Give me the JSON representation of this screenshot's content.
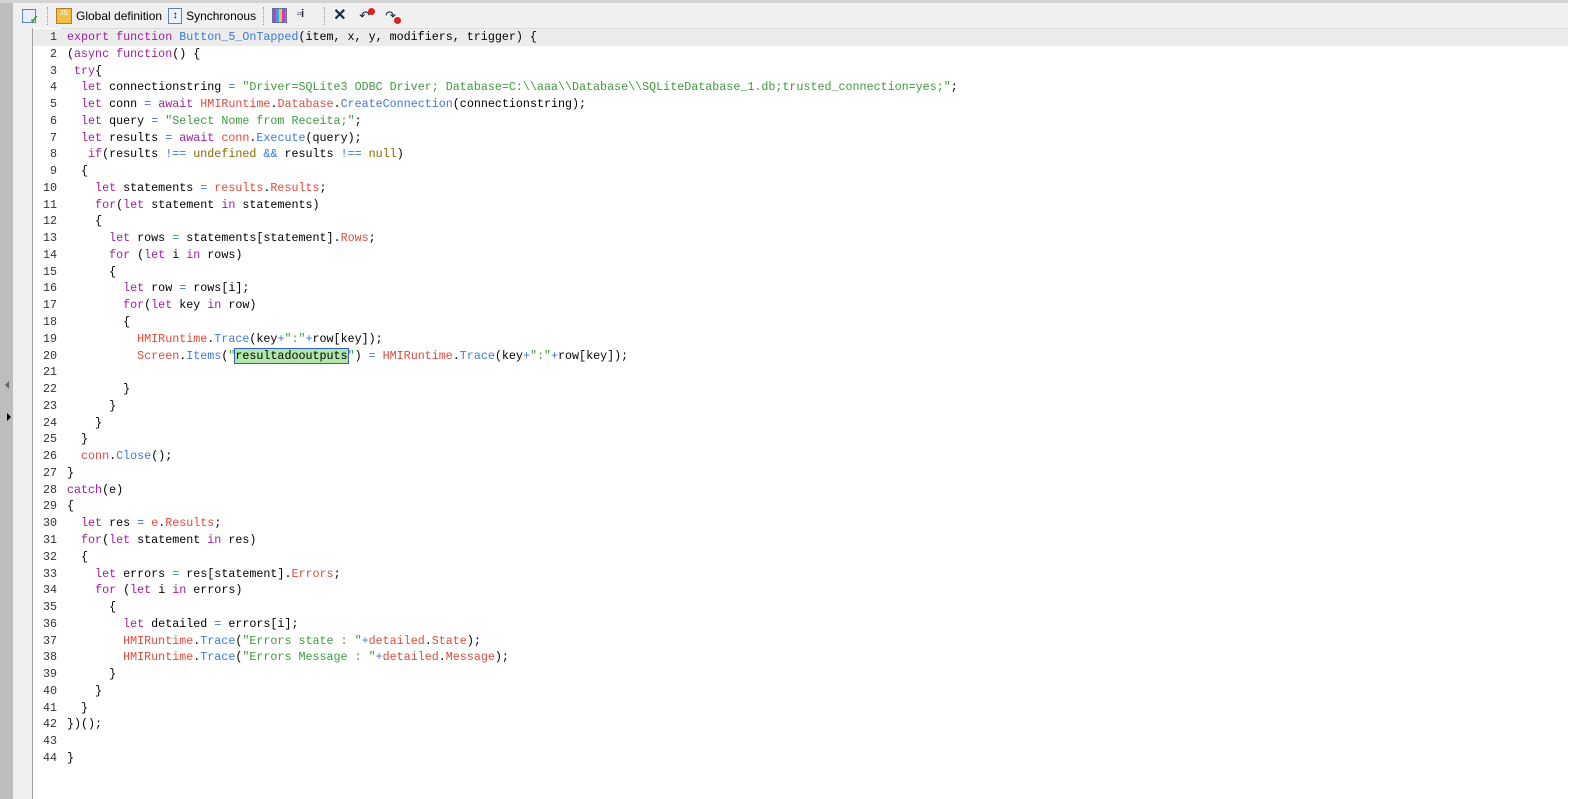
{
  "toolbar": {
    "items": [
      {
        "icon": "check-syntax-icon",
        "label": ""
      },
      {
        "icon": "js-global-definition-icon",
        "label": "Global definition"
      },
      {
        "icon": "synchronous-icon",
        "label": "Synchronous"
      },
      {
        "icon": "snippets-icon",
        "label": ""
      },
      {
        "icon": "info-icon",
        "label": ""
      },
      {
        "icon": "delete-icon",
        "label": ""
      },
      {
        "icon": "remove-breakpoint-icon",
        "label": ""
      },
      {
        "icon": "remove-all-breakpoints-icon",
        "label": ""
      }
    ]
  },
  "colors": {
    "keyword": "#a020a0",
    "function": "#3c78d8",
    "object": "#e04a3c",
    "string": "#3e9a3e",
    "constant": "#8b6a00"
  },
  "code": {
    "current_line": 1,
    "highlight_word": "resultadooutputs",
    "lines": [
      [
        [
          "k",
          "export function "
        ],
        [
          "f",
          "Button_5_OnTapped"
        ],
        [
          "p",
          "(item, x, y, modifiers, trigger) {"
        ]
      ],
      [
        [
          "p",
          "("
        ],
        [
          "k",
          "async function"
        ],
        [
          "p",
          "() {"
        ]
      ],
      [
        [
          "k",
          " try"
        ],
        [
          "p",
          "{"
        ]
      ],
      [
        [
          "k",
          "  let "
        ],
        [
          "p",
          "connectionstring "
        ],
        [
          "f",
          "= "
        ],
        [
          "s",
          "\"Driver=SQLite3 ODBC Driver; Database=C:\\\\aaa\\\\Database\\\\SQLiteDatabase_1.db;trusted_connection=yes;\""
        ],
        [
          "p",
          ";"
        ]
      ],
      [
        [
          "k",
          "  let "
        ],
        [
          "p",
          "conn "
        ],
        [
          "f",
          "= "
        ],
        [
          "k",
          "await "
        ],
        [
          "o",
          "HMIRuntime"
        ],
        [
          "p",
          "."
        ],
        [
          "o",
          "Database"
        ],
        [
          "p",
          "."
        ],
        [
          "f",
          "CreateConnection"
        ],
        [
          "p",
          "(connectionstring);"
        ]
      ],
      [
        [
          "k",
          "  let "
        ],
        [
          "p",
          "query "
        ],
        [
          "f",
          "= "
        ],
        [
          "s",
          "\"Select Nome from Receita;\""
        ],
        [
          "p",
          ";"
        ]
      ],
      [
        [
          "k",
          "  let "
        ],
        [
          "p",
          "results "
        ],
        [
          "f",
          "= "
        ],
        [
          "k",
          "await "
        ],
        [
          "o",
          "conn"
        ],
        [
          "p",
          "."
        ],
        [
          "f",
          "Execute"
        ],
        [
          "p",
          "(query);"
        ]
      ],
      [
        [
          "k",
          "   if"
        ],
        [
          "p",
          "(results "
        ],
        [
          "f",
          "!== "
        ],
        [
          "c",
          "undefined "
        ],
        [
          "f",
          "&& "
        ],
        [
          "p",
          "results "
        ],
        [
          "f",
          "!== "
        ],
        [
          "c",
          "null"
        ],
        [
          "p",
          ")"
        ]
      ],
      [
        [
          "p",
          "  {"
        ]
      ],
      [
        [
          "k",
          "    let "
        ],
        [
          "p",
          "statements "
        ],
        [
          "f",
          "= "
        ],
        [
          "o",
          "results"
        ],
        [
          "p",
          "."
        ],
        [
          "o",
          "Results"
        ],
        [
          "p",
          ";"
        ]
      ],
      [
        [
          "k",
          "    for"
        ],
        [
          "p",
          "("
        ],
        [
          "k",
          "let "
        ],
        [
          "p",
          "statement "
        ],
        [
          "k",
          "in "
        ],
        [
          "p",
          "statements)"
        ]
      ],
      [
        [
          "p",
          "    {"
        ]
      ],
      [
        [
          "k",
          "      let "
        ],
        [
          "p",
          "rows "
        ],
        [
          "f",
          "= "
        ],
        [
          "p",
          "statements[statement]."
        ],
        [
          "o",
          "Rows"
        ],
        [
          "p",
          ";"
        ]
      ],
      [
        [
          "k",
          "      for "
        ],
        [
          "p",
          "("
        ],
        [
          "k",
          "let "
        ],
        [
          "p",
          "i "
        ],
        [
          "k",
          "in "
        ],
        [
          "p",
          "rows)"
        ]
      ],
      [
        [
          "p",
          "      {"
        ]
      ],
      [
        [
          "k",
          "        let "
        ],
        [
          "p",
          "row "
        ],
        [
          "f",
          "= "
        ],
        [
          "p",
          "rows[i];"
        ]
      ],
      [
        [
          "k",
          "        for"
        ],
        [
          "p",
          "("
        ],
        [
          "k",
          "let "
        ],
        [
          "p",
          "key "
        ],
        [
          "k",
          "in "
        ],
        [
          "p",
          "row)"
        ]
      ],
      [
        [
          "p",
          "        {"
        ]
      ],
      [
        [
          "o",
          "          HMIRuntime"
        ],
        [
          "p",
          "."
        ],
        [
          "f",
          "Trace"
        ],
        [
          "p",
          "(key"
        ],
        [
          "f",
          "+"
        ],
        [
          "s",
          "\":\""
        ],
        [
          "f",
          "+"
        ],
        [
          "p",
          "row[key]);"
        ]
      ],
      [
        [
          "o",
          "          Screen"
        ],
        [
          "p",
          "."
        ],
        [
          "f",
          "Items"
        ],
        [
          "p",
          "("
        ],
        [
          "s",
          "\""
        ],
        [
          "hl",
          "resultadooutputs"
        ],
        [
          "s",
          "\""
        ],
        [
          "p",
          ") "
        ],
        [
          "f",
          "= "
        ],
        [
          "o",
          "HMIRuntime"
        ],
        [
          "p",
          "."
        ],
        [
          "f",
          "Trace"
        ],
        [
          "p",
          "(key"
        ],
        [
          "f",
          "+"
        ],
        [
          "s",
          "\":\""
        ],
        [
          "f",
          "+"
        ],
        [
          "p",
          "row[key]);"
        ]
      ],
      [
        [
          "p",
          ""
        ]
      ],
      [
        [
          "p",
          "        }"
        ]
      ],
      [
        [
          "p",
          "      }"
        ]
      ],
      [
        [
          "p",
          "    }"
        ]
      ],
      [
        [
          "p",
          "  }"
        ]
      ],
      [
        [
          "o",
          "  conn"
        ],
        [
          "p",
          "."
        ],
        [
          "f",
          "Close"
        ],
        [
          "p",
          "();"
        ]
      ],
      [
        [
          "p",
          "}"
        ]
      ],
      [
        [
          "k",
          "catch"
        ],
        [
          "p",
          "(e)"
        ]
      ],
      [
        [
          "p",
          "{"
        ]
      ],
      [
        [
          "k",
          "  let "
        ],
        [
          "p",
          "res "
        ],
        [
          "f",
          "= "
        ],
        [
          "o",
          "e"
        ],
        [
          "p",
          "."
        ],
        [
          "o",
          "Results"
        ],
        [
          "p",
          ";"
        ]
      ],
      [
        [
          "k",
          "  for"
        ],
        [
          "p",
          "("
        ],
        [
          "k",
          "let "
        ],
        [
          "p",
          "statement "
        ],
        [
          "k",
          "in "
        ],
        [
          "p",
          "res)"
        ]
      ],
      [
        [
          "p",
          "  {"
        ]
      ],
      [
        [
          "k",
          "    let "
        ],
        [
          "p",
          "errors "
        ],
        [
          "f",
          "= "
        ],
        [
          "p",
          "res[statement]."
        ],
        [
          "o",
          "Errors"
        ],
        [
          "p",
          ";"
        ]
      ],
      [
        [
          "k",
          "    for "
        ],
        [
          "p",
          "("
        ],
        [
          "k",
          "let "
        ],
        [
          "p",
          "i "
        ],
        [
          "k",
          "in "
        ],
        [
          "p",
          "errors)"
        ]
      ],
      [
        [
          "p",
          "      {"
        ]
      ],
      [
        [
          "k",
          "        let "
        ],
        [
          "p",
          "detailed "
        ],
        [
          "f",
          "= "
        ],
        [
          "p",
          "errors[i];"
        ]
      ],
      [
        [
          "o",
          "        HMIRuntime"
        ],
        [
          "p",
          "."
        ],
        [
          "f",
          "Trace"
        ],
        [
          "p",
          "("
        ],
        [
          "s",
          "\"Errors state : \""
        ],
        [
          "f",
          "+"
        ],
        [
          "o",
          "detailed"
        ],
        [
          "p",
          "."
        ],
        [
          "o",
          "State"
        ],
        [
          "p",
          ");"
        ]
      ],
      [
        [
          "o",
          "        HMIRuntime"
        ],
        [
          "p",
          "."
        ],
        [
          "f",
          "Trace"
        ],
        [
          "p",
          "("
        ],
        [
          "s",
          "\"Errors Message : \""
        ],
        [
          "f",
          "+"
        ],
        [
          "o",
          "detailed"
        ],
        [
          "p",
          "."
        ],
        [
          "o",
          "Message"
        ],
        [
          "p",
          ");"
        ]
      ],
      [
        [
          "p",
          "      }"
        ]
      ],
      [
        [
          "p",
          "    }"
        ]
      ],
      [
        [
          "p",
          "  }"
        ]
      ],
      [
        [
          "p",
          "})();"
        ]
      ],
      [
        [
          "p",
          ""
        ]
      ],
      [
        [
          "p",
          "}"
        ]
      ]
    ]
  }
}
